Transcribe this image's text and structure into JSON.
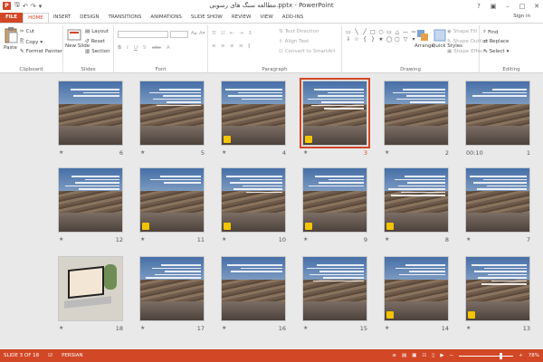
{
  "app": {
    "title": "مطالعه سنگ های رسوبی.pptx - PowerPoint",
    "icon_letter": "P",
    "sign_in": "Sign in"
  },
  "tabs": [
    {
      "label": "FILE"
    },
    {
      "label": "HOME"
    },
    {
      "label": "INSERT"
    },
    {
      "label": "DESIGN"
    },
    {
      "label": "TRANSITIONS"
    },
    {
      "label": "ANIMATIONS"
    },
    {
      "label": "SLIDE SHOW"
    },
    {
      "label": "REVIEW"
    },
    {
      "label": "VIEW"
    },
    {
      "label": "ADD-INS"
    }
  ],
  "ribbon": {
    "clipboard": {
      "label": "Clipboard",
      "paste": "Paste",
      "cut": "Cut",
      "copy": "Copy",
      "format_painter": "Format Painter"
    },
    "slides": {
      "label": "Slides",
      "new_slide": "New Slide",
      "layout": "Layout",
      "reset": "Reset",
      "section": "Section"
    },
    "font": {
      "label": "Font"
    },
    "paragraph": {
      "label": "Paragraph",
      "text_direction": "Text Direction",
      "align_text": "Align Text",
      "convert_smartart": "Convert to SmartArt"
    },
    "drawing": {
      "label": "Drawing",
      "arrange": "Arrange",
      "quick_styles": "Quick Styles",
      "shape_fill": "Shape Fill",
      "shape_outline": "Shape Outline",
      "shape_effects": "Shape Effects"
    },
    "editing": {
      "label": "Editing",
      "find": "Find",
      "replace": "Replace",
      "select": "Select"
    }
  },
  "slides": [
    {
      "num": "1",
      "time": "00:10",
      "kind": "rock",
      "badge": false
    },
    {
      "num": "2",
      "kind": "rock",
      "badge": false
    },
    {
      "num": "3",
      "kind": "rock",
      "badge": true,
      "selected": true
    },
    {
      "num": "4",
      "kind": "rock",
      "badge": true
    },
    {
      "num": "5",
      "kind": "rock",
      "badge": false
    },
    {
      "num": "6",
      "kind": "rock",
      "badge": false
    },
    {
      "num": "7",
      "kind": "rock",
      "badge": false
    },
    {
      "num": "8",
      "kind": "rock",
      "badge": true
    },
    {
      "num": "9",
      "kind": "rock",
      "badge": true
    },
    {
      "num": "10",
      "kind": "rock",
      "badge": true
    },
    {
      "num": "11",
      "kind": "rock",
      "badge": true
    },
    {
      "num": "12",
      "kind": "rock",
      "badge": false
    },
    {
      "num": "13",
      "kind": "rock",
      "badge": true
    },
    {
      "num": "14",
      "kind": "rock",
      "badge": true
    },
    {
      "num": "15",
      "kind": "rock",
      "badge": false
    },
    {
      "num": "16",
      "kind": "rock",
      "badge": false
    },
    {
      "num": "17",
      "kind": "rock",
      "badge": false
    },
    {
      "num": "18",
      "kind": "laptop",
      "badge": false
    }
  ],
  "status": {
    "slide_info": "SLIDE 3 OF 18",
    "language": "PERSIAN",
    "zoom": "78%",
    "zoom_level": 0.78
  },
  "colors": {
    "accent": "#d24726"
  }
}
